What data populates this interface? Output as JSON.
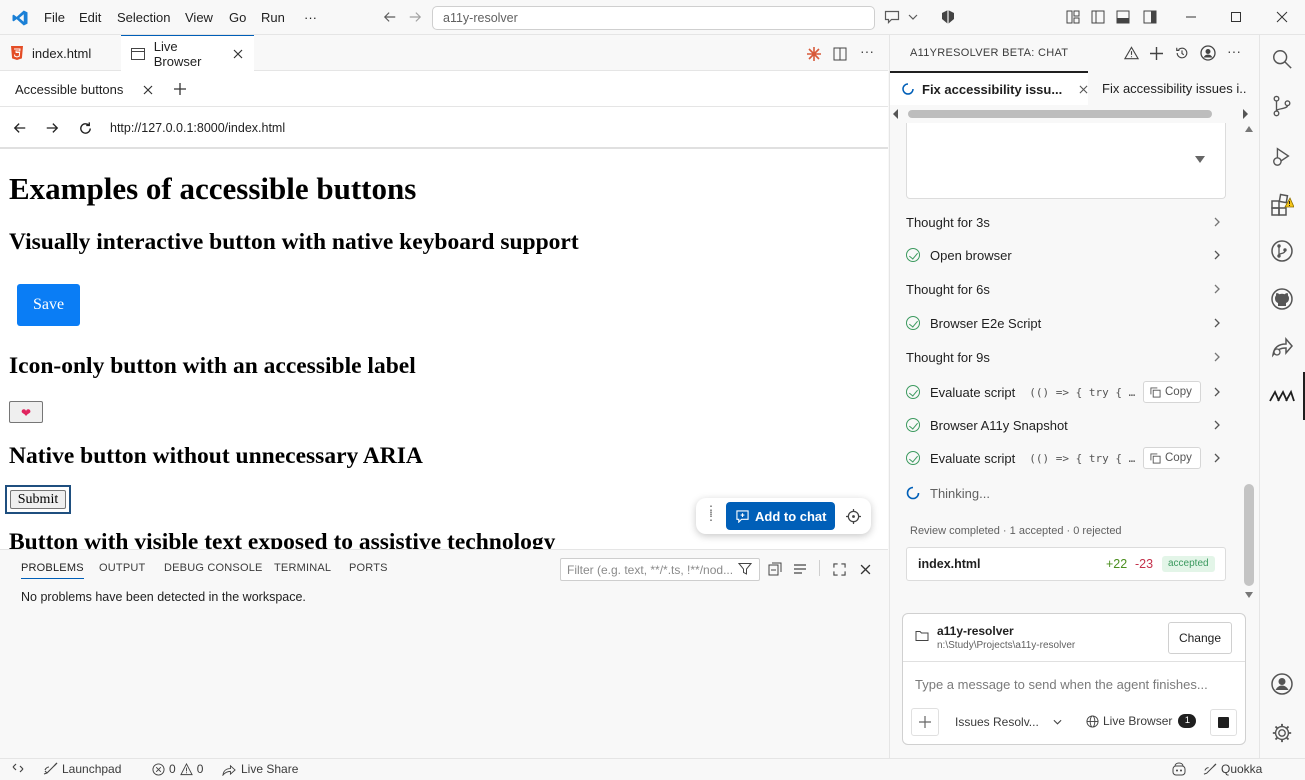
{
  "titlebar": {
    "menus": [
      "File",
      "Edit",
      "Selection",
      "View",
      "Go",
      "Run",
      "···"
    ],
    "search_text": "a11y-resolver"
  },
  "editor_tabs": [
    {
      "label": "index.html"
    },
    {
      "label": "Live Browser"
    }
  ],
  "browser": {
    "tab_label": "Accessible buttons",
    "url": "http://127.0.0.1:8000/index.html"
  },
  "page": {
    "h1": "Examples of accessible buttons",
    "section1": "Visually interactive button with native keyboard support",
    "save_label": "Save",
    "section2": "Icon-only button with an accessible label",
    "heart": "❤",
    "section3": "Native button without unnecessary ARIA",
    "submit_label": "Submit",
    "section4": "Button with visible text exposed to assistive technology"
  },
  "add_to_chat": "Add to chat",
  "panel": {
    "tabs": [
      "PROBLEMS",
      "OUTPUT",
      "DEBUG CONSOLE",
      "TERMINAL",
      "PORTS"
    ],
    "filter_placeholder": "Filter (e.g. text, **/*.ts, !**/nod...",
    "message": "No problems have been detected in the workspace."
  },
  "chat": {
    "title": "A11YRESOLVER BETA: CHAT",
    "tabs": [
      "Fix accessibility issu...",
      "Fix accessibility issues i..."
    ],
    "steps": [
      {
        "kind": "thought",
        "label": "Thought for 3s"
      },
      {
        "kind": "done",
        "label": "Open browser"
      },
      {
        "kind": "thought",
        "label": "Thought for 6s"
      },
      {
        "kind": "done",
        "label": "Browser E2e Script"
      },
      {
        "kind": "thought",
        "label": "Thought for 9s"
      },
      {
        "kind": "done",
        "label": "Evaluate script",
        "code": "(() => { try { …",
        "copy": "Copy"
      },
      {
        "kind": "done",
        "label": "Browser A11y Snapshot"
      },
      {
        "kind": "done",
        "label": "Evaluate script",
        "code": "(() => { try { …",
        "copy": "Copy"
      },
      {
        "kind": "progress",
        "label": "Thinking..."
      }
    ],
    "review": "Review completed · 1 accepted · 0 rejected",
    "file": {
      "name": "index.html",
      "added": "+22",
      "removed": "-23",
      "status": "accepted"
    },
    "workspace": {
      "name": "a11y-resolver",
      "path": "n:\\Study\\Projects\\a11y-resolver",
      "change": "Change"
    },
    "input_placeholder": "Type a message to send when the agent finishes...",
    "mode": "Issues Resolv...",
    "live_browser": "Live Browser",
    "live_browser_count": "1"
  },
  "status": {
    "launchpad": "Launchpad",
    "errors": "0",
    "warnings": "0",
    "live_share": "Live Share",
    "quokka": "Quokka"
  },
  "colors": {
    "accent": "#005fb8",
    "save_button": "#0a7df5",
    "success": "#3c9a5f",
    "added": "#4b8f1f",
    "removed": "#c4314b"
  }
}
